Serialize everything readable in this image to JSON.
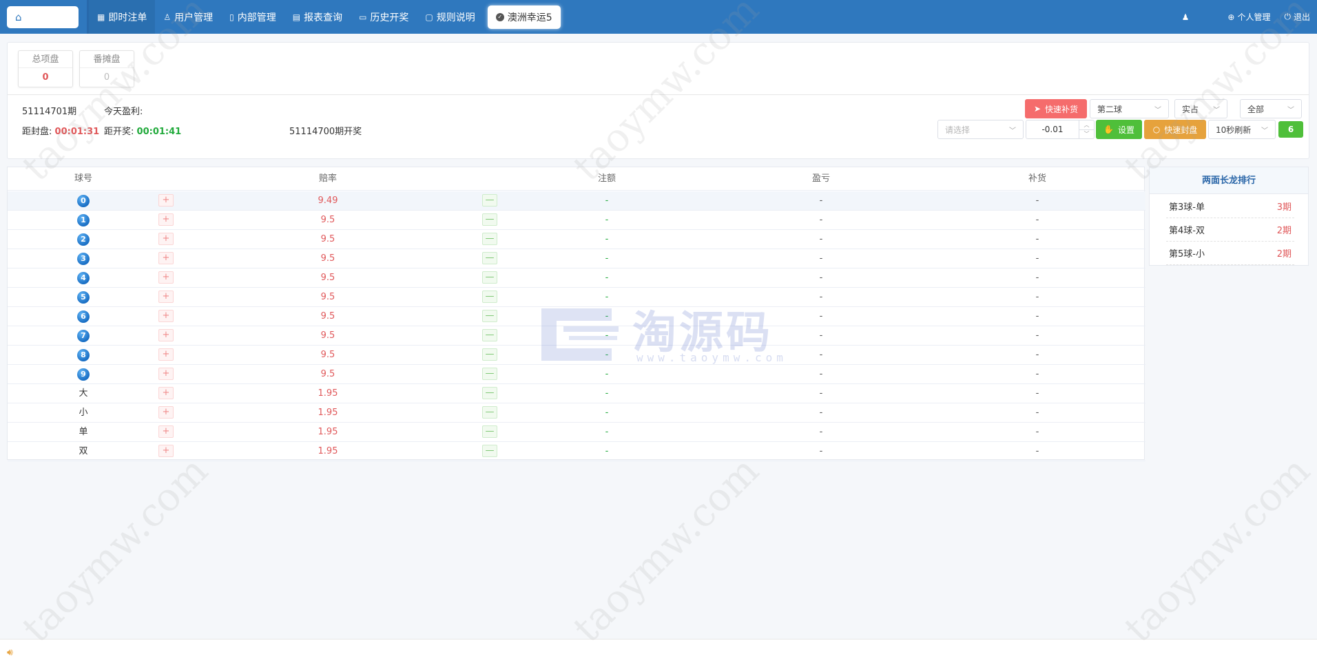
{
  "nav": {
    "items": [
      {
        "icon": "grid-icon",
        "glyph": "▦",
        "label": "即时注单"
      },
      {
        "icon": "user-icon",
        "glyph": "♙",
        "label": "用户管理"
      },
      {
        "icon": "book-icon",
        "glyph": "▯",
        "label": "内部管理"
      },
      {
        "icon": "report-icon",
        "glyph": "▤",
        "label": "报表查询"
      },
      {
        "icon": "monitor-icon",
        "glyph": "▭",
        "label": "历史开奖"
      },
      {
        "icon": "comment-icon",
        "glyph": "▢",
        "label": "规则说明"
      }
    ],
    "game_tab": "澳洲幸运5",
    "right": {
      "profile": "个人管理",
      "logout": "退出"
    }
  },
  "stats": {
    "total_label": "总项盘",
    "total_value": "0",
    "fan_label": "番摊盘",
    "fan_value": "0"
  },
  "period": {
    "current": "51114701期",
    "profit_label": "今天盈利:",
    "close_label": "距封盘:",
    "close_time": "00:01:31",
    "open_label": "距开奖:",
    "open_time": "00:01:41",
    "last_draw": "51114700期开奖"
  },
  "controls": {
    "quick_restock": "快速补货",
    "ball_select": "第二球",
    "mode_select": "实占",
    "scope_select": "全部",
    "choose_placeholder": "请选择",
    "step_value": "-0.01",
    "settings": "设置",
    "quick_close": "快速封盘",
    "refresh_select": "10秒刷新",
    "refresh_count": "6"
  },
  "table": {
    "headers": {
      "ball": "球号",
      "odds": "赔率",
      "bet": "注额",
      "profit": "盈亏",
      "restock": "补货"
    },
    "rows": [
      {
        "ball": "0",
        "is_ball": true,
        "odds": "9.49",
        "bet": "-",
        "profit": "-",
        "restock": "-"
      },
      {
        "ball": "1",
        "is_ball": true,
        "odds": "9.5",
        "bet": "-",
        "profit": "-",
        "restock": "-"
      },
      {
        "ball": "2",
        "is_ball": true,
        "odds": "9.5",
        "bet": "-",
        "profit": "-",
        "restock": "-"
      },
      {
        "ball": "3",
        "is_ball": true,
        "odds": "9.5",
        "bet": "-",
        "profit": "-",
        "restock": "-"
      },
      {
        "ball": "4",
        "is_ball": true,
        "odds": "9.5",
        "bet": "-",
        "profit": "-",
        "restock": "-"
      },
      {
        "ball": "5",
        "is_ball": true,
        "odds": "9.5",
        "bet": "-",
        "profit": "-",
        "restock": "-"
      },
      {
        "ball": "6",
        "is_ball": true,
        "odds": "9.5",
        "bet": "-",
        "profit": "-",
        "restock": "-"
      },
      {
        "ball": "7",
        "is_ball": true,
        "odds": "9.5",
        "bet": "-",
        "profit": "-",
        "restock": "-"
      },
      {
        "ball": "8",
        "is_ball": true,
        "odds": "9.5",
        "bet": "-",
        "profit": "-",
        "restock": "-"
      },
      {
        "ball": "9",
        "is_ball": true,
        "odds": "9.5",
        "bet": "-",
        "profit": "-",
        "restock": "-"
      },
      {
        "ball": "大",
        "is_ball": false,
        "odds": "1.95",
        "bet": "-",
        "profit": "-",
        "restock": "-"
      },
      {
        "ball": "小",
        "is_ball": false,
        "odds": "1.95",
        "bet": "-",
        "profit": "-",
        "restock": "-"
      },
      {
        "ball": "单",
        "is_ball": false,
        "odds": "1.95",
        "bet": "-",
        "profit": "-",
        "restock": "-"
      },
      {
        "ball": "双",
        "is_ball": false,
        "odds": "1.95",
        "bet": "-",
        "profit": "-",
        "restock": "-"
      }
    ],
    "plus": "+",
    "minus": "—"
  },
  "ranking": {
    "title": "两面长龙排行",
    "items": [
      {
        "name": "第3球-单",
        "count": "3期"
      },
      {
        "name": "第4球-双",
        "count": "2期"
      },
      {
        "name": "第5球-小",
        "count": "2期"
      }
    ]
  },
  "watermark": {
    "text": "taoymw.com",
    "logo_cn": "淘源码",
    "logo_en": "www.taoymw.com"
  },
  "colors": {
    "primary": "#2f78be",
    "red": "#e0585a",
    "green": "#22aa3c",
    "orange": "#e6a23c"
  }
}
